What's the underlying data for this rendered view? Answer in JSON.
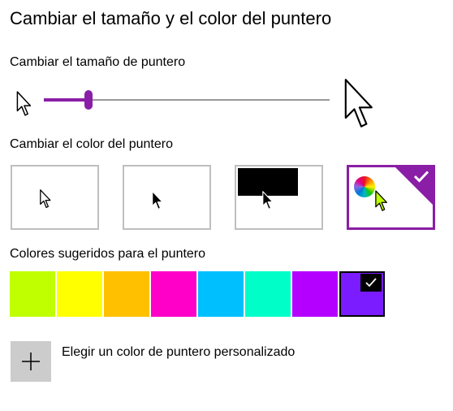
{
  "page": {
    "title": "Cambiar el tamaño y el color del puntero"
  },
  "size_section": {
    "label": "Cambiar el tamaño de puntero",
    "slider_value_fraction": 0.155
  },
  "color_section": {
    "label": "Cambiar el color del puntero",
    "schemes": [
      {
        "id": "white",
        "selected": false
      },
      {
        "id": "black",
        "selected": false
      },
      {
        "id": "inverted",
        "selected": false
      },
      {
        "id": "custom",
        "selected": true,
        "icon": "color-wheel-icon"
      }
    ]
  },
  "suggested_section": {
    "label": "Colores sugeridos para el puntero",
    "colors": [
      "#c0ff00",
      "#ffff00",
      "#ffc000",
      "#ff00c8",
      "#00bfff",
      "#00ffc8",
      "#b400ff",
      "#7a1cff"
    ],
    "selected_index": 7
  },
  "custom_color": {
    "label": "Elegir un color de puntero personalizado",
    "icon": "plus-icon"
  },
  "colors": {
    "accent": "#8a1ea6",
    "custom_cursor": "#c0ff00"
  }
}
